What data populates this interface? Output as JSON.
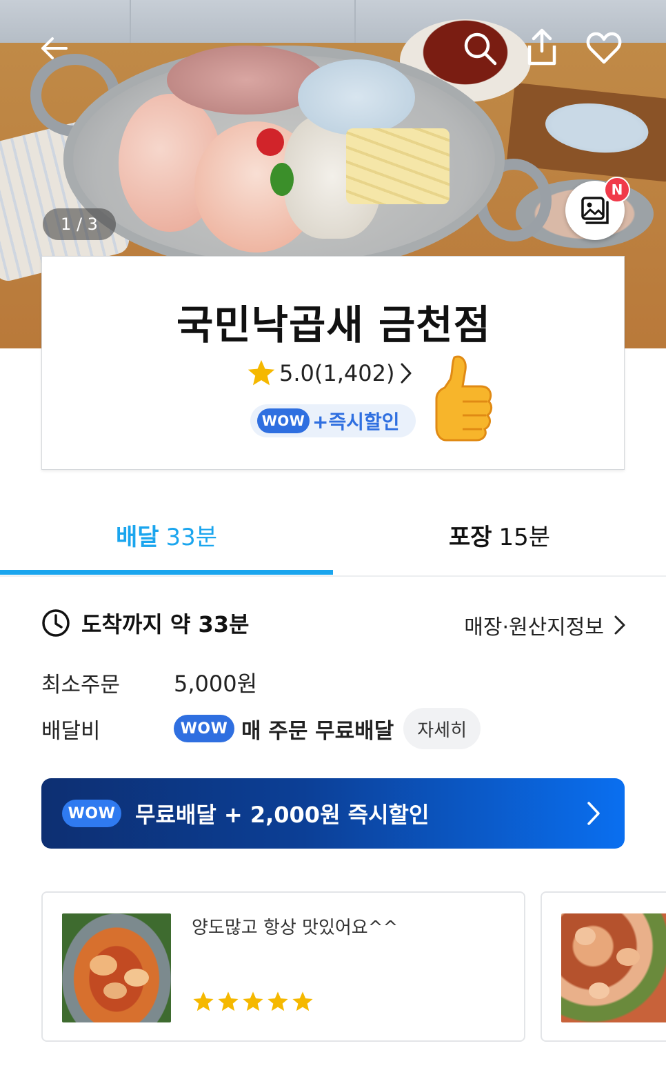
{
  "hero": {
    "page_indicator": "1 / 3",
    "new_badge": "N",
    "icons": [
      "back-arrow-icon",
      "search-icon",
      "share-icon",
      "heart-icon",
      "photo-gallery-icon"
    ]
  },
  "store": {
    "name": "국민낙곱새 금천점",
    "rating": "5.0(1,402)",
    "wow_label": "WOW",
    "promo": "+즉시할인"
  },
  "tabs": [
    {
      "label": "배달",
      "time": "33분",
      "active": true
    },
    {
      "label": "포장",
      "time": "15분",
      "active": false
    }
  ],
  "info": {
    "arrival": "도착까지 약 33분",
    "store_info_link": "매장·원산지정보",
    "min_order_label": "최소주문",
    "min_order_value": "5,000원",
    "delivery_fee_label": "배달비",
    "wow_label": "WOW",
    "delivery_fee_value": "매 주문 무료배달",
    "detail_button": "자세히"
  },
  "banner": {
    "wow_label": "WOW",
    "text": "무료배달 + 2,000원 즉시할인"
  },
  "reviews": [
    {
      "text": "양도많고 항상 맛있어요^^",
      "stars": 5
    }
  ],
  "colors": {
    "accent": "#1aa5ee",
    "wow_blue": "#2f6fe0",
    "banner_dark": "#0d2f72",
    "banner_light": "#0a6ff0",
    "star": "#f5b800",
    "badge_red": "#f03a4a"
  }
}
